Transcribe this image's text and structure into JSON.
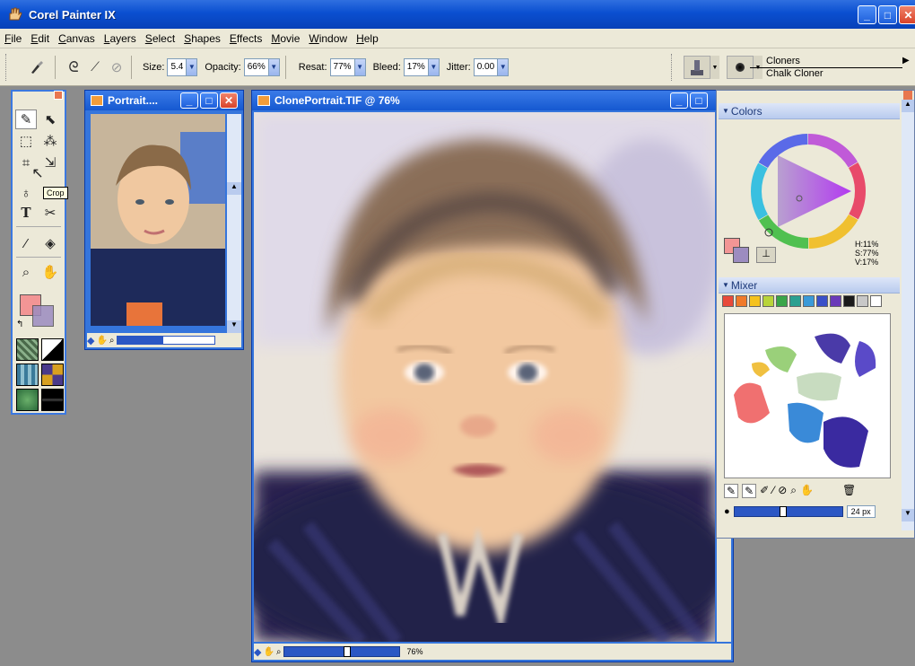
{
  "app": {
    "title": "Corel Painter IX"
  },
  "menu": [
    "File",
    "Edit",
    "Canvas",
    "Layers",
    "Select",
    "Shapes",
    "Effects",
    "Movie",
    "Window",
    "Help"
  ],
  "propbar": {
    "size_label": "Size:",
    "size_value": "5.4",
    "opacity_label": "Opacity:",
    "opacity_value": "66%",
    "resat_label": "Resat:",
    "resat_value": "77%",
    "bleed_label": "Bleed:",
    "bleed_value": "17%",
    "jitter_label": "Jitter:",
    "jitter_value": "0.00",
    "brush_category": "Cloners",
    "brush_variant": "Chalk Cloner"
  },
  "toolbox": {
    "tooltip": "Crop"
  },
  "source_window": {
    "title": "Portrait...."
  },
  "canvas_window": {
    "title": "ClonePortrait.TIF @ 76%",
    "zoom_label": "76%",
    "zoom_fraction": 0.55
  },
  "colors_panel": {
    "title": "Colors",
    "hue": "H:11%",
    "sat": "S:77%",
    "val": "V:17%"
  },
  "mixer_panel": {
    "title": "Mixer",
    "brush_size": "24 px",
    "brush_fraction": 0.45,
    "swatches": [
      "#e84a3a",
      "#f07a2a",
      "#f5c21c",
      "#b8d43a",
      "#3aa548",
      "#2aa090",
      "#3a9ad8",
      "#3a50c8",
      "#6a3ab8",
      "#1a1a1a",
      "#c8c8c8",
      "#ffffff"
    ]
  },
  "colors": {
    "accent": "#0a4fd0",
    "primary_color": "#f29595",
    "secondary_color": "#9c8cc0"
  }
}
